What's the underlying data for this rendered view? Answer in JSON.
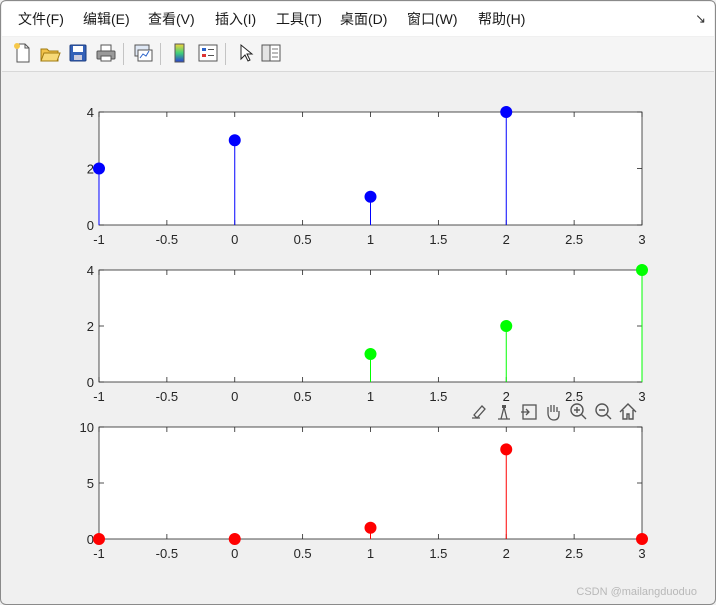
{
  "menu": {
    "items": [
      "文件(F)",
      "编辑(E)",
      "查看(V)",
      "插入(I)",
      "工具(T)",
      "桌面(D)",
      "窗口(W)",
      "帮助(H)"
    ],
    "overflow_icon": "curved-arrow-icon"
  },
  "toolbar": {
    "icons": [
      "new-figure-icon",
      "open-file-icon",
      "save-icon",
      "print-icon",
      "link-plot-icon",
      "insert-colorbar-icon",
      "insert-legend-icon",
      "edit-plot-arrow-icon",
      "property-inspector-icon"
    ]
  },
  "axes_toolbar": {
    "icons": [
      "brush-data-icon",
      "data-tips-icon",
      "export-icon",
      "pan-hand-icon",
      "zoom-in-icon",
      "zoom-out-icon",
      "restore-home-icon"
    ]
  },
  "watermark": "CSDN @mailangduoduo",
  "chart_data": [
    {
      "type": "stem",
      "x": [
        -1,
        0,
        1,
        2
      ],
      "y": [
        2,
        3,
        1,
        4
      ],
      "xlim": [
        -1,
        3
      ],
      "ylim": [
        0,
        4
      ],
      "xticks": [
        "-1",
        "-0.5",
        "0",
        "0.5",
        "1",
        "1.5",
        "2",
        "2.5",
        "3"
      ],
      "yticks": [
        "0",
        "2",
        "4"
      ],
      "color": "#0000ff",
      "grid": false
    },
    {
      "type": "stem",
      "x": [
        1,
        2,
        3
      ],
      "y": [
        1,
        2,
        4
      ],
      "xlim": [
        -1,
        3
      ],
      "ylim": [
        0,
        4
      ],
      "xticks": [
        "-1",
        "-0.5",
        "0",
        "0.5",
        "1",
        "1.5",
        "2",
        "2.5",
        "3"
      ],
      "yticks": [
        "0",
        "2",
        "4"
      ],
      "color": "#00ff00",
      "grid": false
    },
    {
      "type": "stem",
      "x": [
        -1,
        0,
        1,
        2,
        3
      ],
      "y": [
        0,
        0,
        1,
        8,
        0
      ],
      "xlim": [
        -1,
        3
      ],
      "ylim": [
        0,
        10
      ],
      "xticks": [
        "-1",
        "-0.5",
        "0",
        "0.5",
        "1",
        "1.5",
        "2",
        "2.5",
        "3"
      ],
      "yticks": [
        "0",
        "5",
        "10"
      ],
      "color": "#ff0000",
      "grid": false
    }
  ]
}
